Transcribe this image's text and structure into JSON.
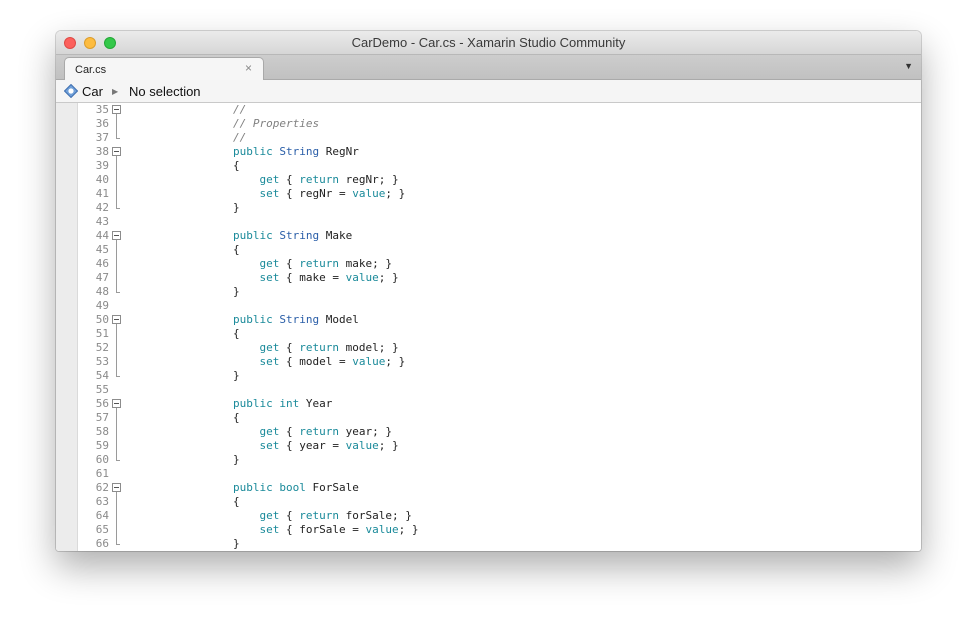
{
  "window": {
    "title": "CarDemo - Car.cs - Xamarin Studio Community"
  },
  "tabs": [
    {
      "label": "Car.cs",
      "close_glyph": "×"
    }
  ],
  "tabbar": {
    "dropdown_glyph": "▼"
  },
  "pathbar": {
    "class_name": "Car",
    "separator_glyph": "▶",
    "member": "No selection"
  },
  "colors": {
    "keyword": "#1a8a9a",
    "type": "#2a5ea8",
    "comment": "#808080",
    "plain": "#222222"
  },
  "editor": {
    "lines": [
      {
        "n": "35",
        "fold": "start",
        "tokens": [
          {
            "t": "        "
          },
          {
            "t": "//",
            "c": "comment"
          }
        ]
      },
      {
        "n": "36",
        "fold": "mid",
        "tokens": [
          {
            "t": "        "
          },
          {
            "t": "// Properties",
            "c": "comment"
          }
        ]
      },
      {
        "n": "37",
        "fold": "end",
        "tokens": [
          {
            "t": "        "
          },
          {
            "t": "//",
            "c": "comment"
          }
        ]
      },
      {
        "n": "38",
        "fold": "start",
        "tokens": [
          {
            "t": "        "
          },
          {
            "t": "public",
            "c": "kw"
          },
          {
            "t": " "
          },
          {
            "t": "String",
            "c": "type"
          },
          {
            "t": " RegNr"
          }
        ]
      },
      {
        "n": "39",
        "fold": "mid",
        "tokens": [
          {
            "t": "        {"
          }
        ]
      },
      {
        "n": "40",
        "fold": "mid",
        "tokens": [
          {
            "t": "            "
          },
          {
            "t": "get",
            "c": "kw"
          },
          {
            "t": " { "
          },
          {
            "t": "return",
            "c": "kw"
          },
          {
            "t": " regNr; }"
          }
        ]
      },
      {
        "n": "41",
        "fold": "mid",
        "tokens": [
          {
            "t": "            "
          },
          {
            "t": "set",
            "c": "kw"
          },
          {
            "t": " { regNr = "
          },
          {
            "t": "value",
            "c": "kw"
          },
          {
            "t": "; }"
          }
        ]
      },
      {
        "n": "42",
        "fold": "end",
        "tokens": [
          {
            "t": "        }"
          }
        ]
      },
      {
        "n": "43",
        "fold": "",
        "tokens": []
      },
      {
        "n": "44",
        "fold": "start",
        "tokens": [
          {
            "t": "        "
          },
          {
            "t": "public",
            "c": "kw"
          },
          {
            "t": " "
          },
          {
            "t": "String",
            "c": "type"
          },
          {
            "t": " Make"
          }
        ]
      },
      {
        "n": "45",
        "fold": "mid",
        "tokens": [
          {
            "t": "        {"
          }
        ]
      },
      {
        "n": "46",
        "fold": "mid",
        "tokens": [
          {
            "t": "            "
          },
          {
            "t": "get",
            "c": "kw"
          },
          {
            "t": " { "
          },
          {
            "t": "return",
            "c": "kw"
          },
          {
            "t": " make; }"
          }
        ]
      },
      {
        "n": "47",
        "fold": "mid",
        "tokens": [
          {
            "t": "            "
          },
          {
            "t": "set",
            "c": "kw"
          },
          {
            "t": " { make = "
          },
          {
            "t": "value",
            "c": "kw"
          },
          {
            "t": "; }"
          }
        ]
      },
      {
        "n": "48",
        "fold": "end",
        "tokens": [
          {
            "t": "        }"
          }
        ]
      },
      {
        "n": "49",
        "fold": "",
        "tokens": []
      },
      {
        "n": "50",
        "fold": "start",
        "tokens": [
          {
            "t": "        "
          },
          {
            "t": "public",
            "c": "kw"
          },
          {
            "t": " "
          },
          {
            "t": "String",
            "c": "type"
          },
          {
            "t": " Model"
          }
        ]
      },
      {
        "n": "51",
        "fold": "mid",
        "tokens": [
          {
            "t": "        {"
          }
        ]
      },
      {
        "n": "52",
        "fold": "mid",
        "tokens": [
          {
            "t": "            "
          },
          {
            "t": "get",
            "c": "kw"
          },
          {
            "t": " { "
          },
          {
            "t": "return",
            "c": "kw"
          },
          {
            "t": " model; }"
          }
        ]
      },
      {
        "n": "53",
        "fold": "mid",
        "tokens": [
          {
            "t": "            "
          },
          {
            "t": "set",
            "c": "kw"
          },
          {
            "t": " { model = "
          },
          {
            "t": "value",
            "c": "kw"
          },
          {
            "t": "; }"
          }
        ]
      },
      {
        "n": "54",
        "fold": "end",
        "tokens": [
          {
            "t": "        }"
          }
        ]
      },
      {
        "n": "55",
        "fold": "",
        "tokens": []
      },
      {
        "n": "56",
        "fold": "start",
        "tokens": [
          {
            "t": "        "
          },
          {
            "t": "public",
            "c": "kw"
          },
          {
            "t": " "
          },
          {
            "t": "int",
            "c": "kw"
          },
          {
            "t": " Year"
          }
        ]
      },
      {
        "n": "57",
        "fold": "mid",
        "tokens": [
          {
            "t": "        {"
          }
        ]
      },
      {
        "n": "58",
        "fold": "mid",
        "tokens": [
          {
            "t": "            "
          },
          {
            "t": "get",
            "c": "kw"
          },
          {
            "t": " { "
          },
          {
            "t": "return",
            "c": "kw"
          },
          {
            "t": " year; }"
          }
        ]
      },
      {
        "n": "59",
        "fold": "mid",
        "tokens": [
          {
            "t": "            "
          },
          {
            "t": "set",
            "c": "kw"
          },
          {
            "t": " { year = "
          },
          {
            "t": "value",
            "c": "kw"
          },
          {
            "t": "; }"
          }
        ]
      },
      {
        "n": "60",
        "fold": "end",
        "tokens": [
          {
            "t": "        }"
          }
        ]
      },
      {
        "n": "61",
        "fold": "",
        "tokens": []
      },
      {
        "n": "62",
        "fold": "start",
        "tokens": [
          {
            "t": "        "
          },
          {
            "t": "public",
            "c": "kw"
          },
          {
            "t": " "
          },
          {
            "t": "bool",
            "c": "kw"
          },
          {
            "t": " ForSale"
          }
        ]
      },
      {
        "n": "63",
        "fold": "mid",
        "tokens": [
          {
            "t": "        {"
          }
        ]
      },
      {
        "n": "64",
        "fold": "mid",
        "tokens": [
          {
            "t": "            "
          },
          {
            "t": "get",
            "c": "kw"
          },
          {
            "t": " { "
          },
          {
            "t": "return",
            "c": "kw"
          },
          {
            "t": " forSale; }"
          }
        ]
      },
      {
        "n": "65",
        "fold": "mid",
        "tokens": [
          {
            "t": "            "
          },
          {
            "t": "set",
            "c": "kw"
          },
          {
            "t": " { forSale = "
          },
          {
            "t": "value",
            "c": "kw"
          },
          {
            "t": "; }"
          }
        ]
      },
      {
        "n": "66",
        "fold": "end",
        "tokens": [
          {
            "t": "        }"
          }
        ]
      }
    ]
  }
}
